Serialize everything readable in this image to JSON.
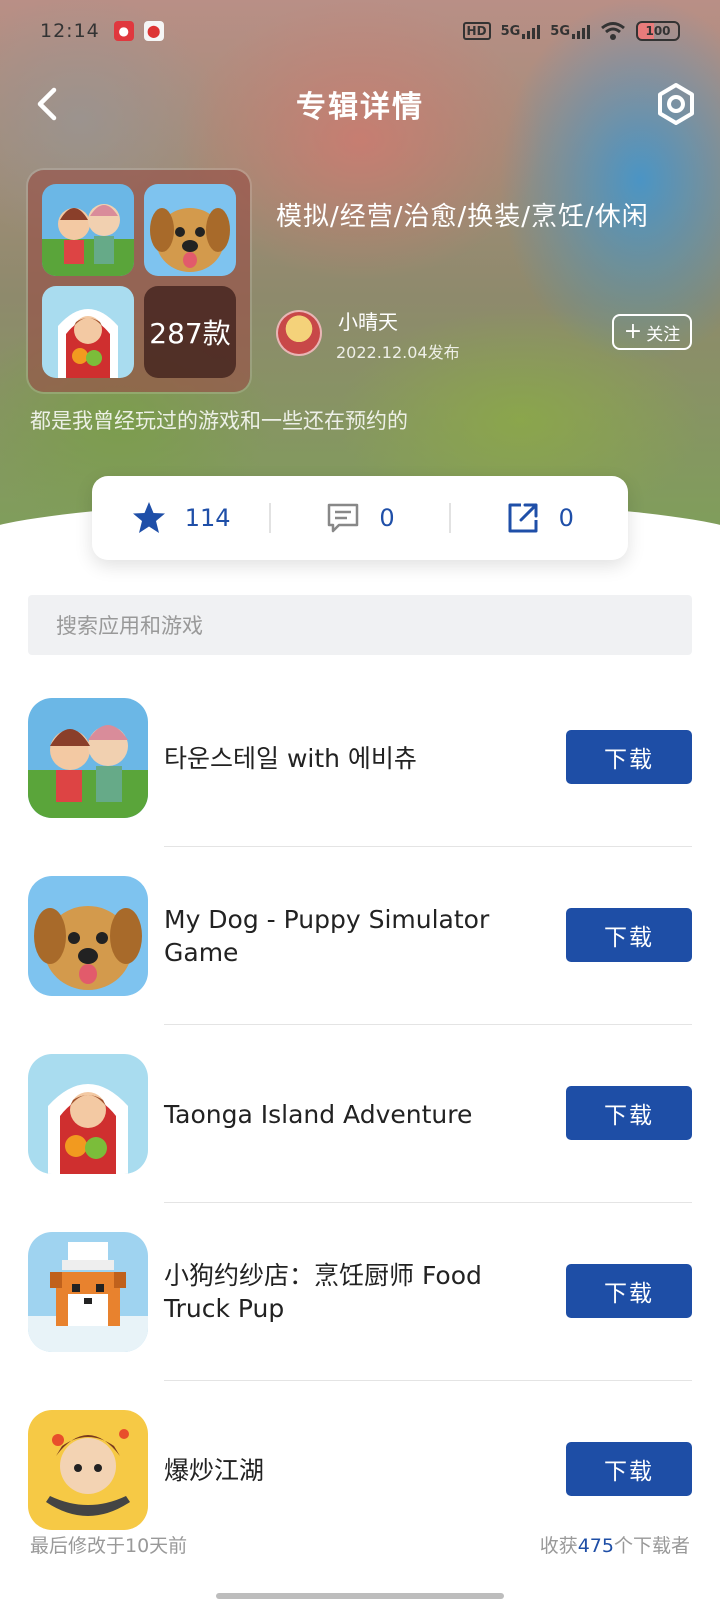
{
  "status_bar": {
    "time": "12:14",
    "hd": "HD",
    "net1": "5G",
    "net2": "5G",
    "battery": "100"
  },
  "header": {
    "title": "专辑详情"
  },
  "album": {
    "count": "287款",
    "title": "模拟/经营/治愈/换装/烹饪/休闲",
    "author": "小晴天",
    "publish_date": "2022.12.04发布",
    "follow_label": "关注",
    "description": "都是我曾经玩过的游戏和一些还在预约的"
  },
  "stats": {
    "likes": "114",
    "comments": "0",
    "shares": "0"
  },
  "search": {
    "placeholder": "搜索应用和游戏"
  },
  "apps": [
    {
      "name": "타운스테일 with 에비츄",
      "button": "下载"
    },
    {
      "name": "My Dog - Puppy Simulator Game",
      "button": "下载"
    },
    {
      "name": "Taonga Island Adventure",
      "button": "下载"
    },
    {
      "name": "小狗约纱店：烹饪厨师 Food Truck Pup",
      "button": "下载"
    },
    {
      "name": "爆炒江湖",
      "button": "下载"
    }
  ],
  "footer": {
    "modified": "最后修改于10天前",
    "collected_prefix": "收获",
    "collected_count": "475",
    "collected_suffix": "个下载者"
  },
  "colors": {
    "accent": "#1e4ea6",
    "search_bg": "#f0f1f3"
  }
}
